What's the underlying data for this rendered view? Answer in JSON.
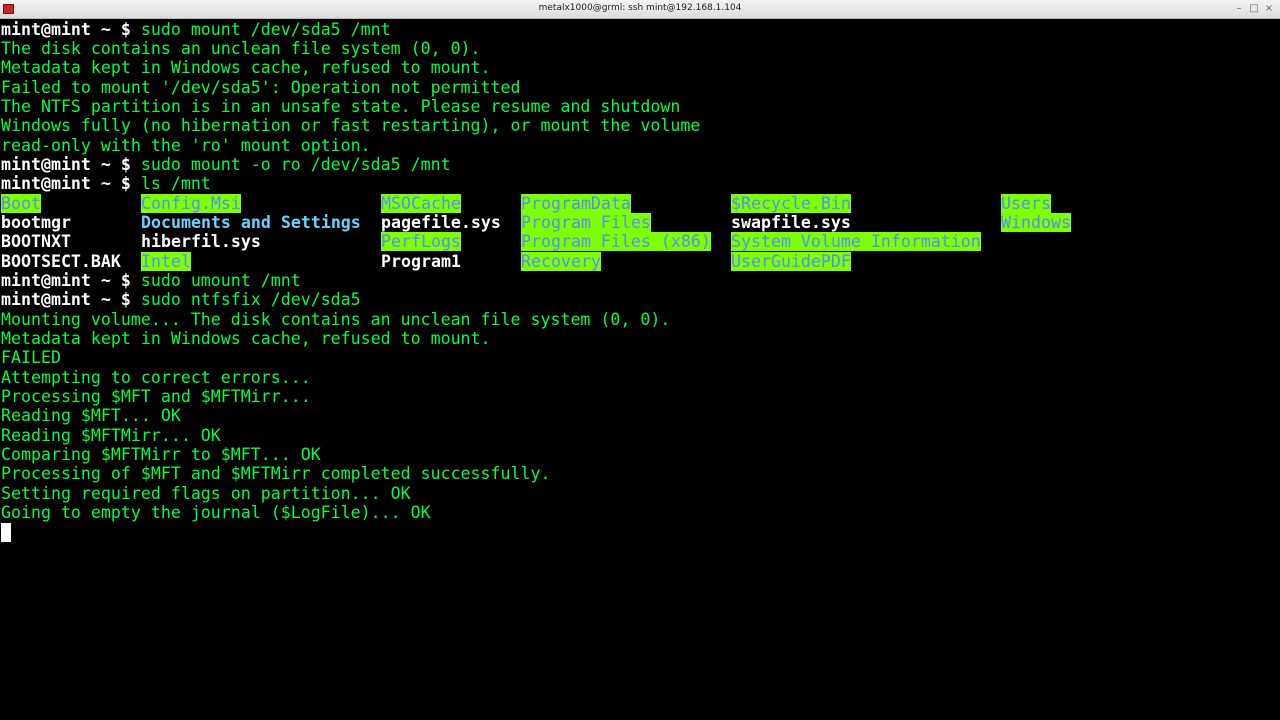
{
  "window": {
    "title": "metalx1000@grml: ssh mint@192.168.1.104",
    "controls": {
      "minimize": "–",
      "maximize": "□",
      "close": "×"
    }
  },
  "terminal": {
    "prompt": "mint@mint ~ $",
    "lines": [
      {
        "prompt": "mint@mint ~ $",
        "text": " sudo mount /dev/sda5 /mnt"
      },
      {
        "text": "The disk contains an unclean file system (0, 0)."
      },
      {
        "text": "Metadata kept in Windows cache, refused to mount."
      },
      {
        "text": "Failed to mount '/dev/sda5': Operation not permitted"
      },
      {
        "text": "The NTFS partition is in an unsafe state. Please resume and shutdown"
      },
      {
        "text": "Windows fully (no hibernation or fast restarting), or mount the volume"
      },
      {
        "text": "read-only with the 'ro' mount option."
      },
      {
        "prompt": "mint@mint ~ $",
        "text": " sudo mount -o ro /dev/sda5 /mnt"
      },
      {
        "prompt": "mint@mint ~ $",
        "text": " ls /mnt"
      }
    ],
    "ls_output": {
      "row1": [
        "Boot",
        "Config.Msi",
        "MSOCache",
        "ProgramData",
        "$Recycle.Bin",
        "Users"
      ],
      "row2": [
        "bootmgr",
        "Documents and Settings",
        "pagefile.sys",
        "Program Files",
        "swapfile.sys",
        "Windows"
      ],
      "row3": [
        "BOOTNXT",
        "hiberfil.sys",
        "PerfLogs",
        "Program Files (x86)",
        "System Volume Information"
      ],
      "row4": [
        "BOOTSECT.BAK",
        "Intel",
        "Program1",
        "Recovery",
        "UserGuidePDF"
      ]
    },
    "lines_after": [
      {
        "prompt": "mint@mint ~ $",
        "text": " sudo umount /mnt"
      },
      {
        "prompt": "mint@mint ~ $",
        "text": " sudo ntfsfix /dev/sda5"
      },
      {
        "text": "Mounting volume... The disk contains an unclean file system (0, 0)."
      },
      {
        "text": "Metadata kept in Windows cache, refused to mount."
      },
      {
        "text": "FAILED"
      },
      {
        "text": "Attempting to correct errors..."
      },
      {
        "text": "Processing $MFT and $MFTMirr..."
      },
      {
        "text": "Reading $MFT... OK"
      },
      {
        "text": "Reading $MFTMirr... OK"
      },
      {
        "text": "Comparing $MFTMirr to $MFT... OK"
      },
      {
        "text": "Processing of $MFT and $MFTMirr completed successfully."
      },
      {
        "text": "Setting required flags on partition... OK"
      },
      {
        "text": "Going to empty the journal ($LogFile)... OK"
      }
    ]
  },
  "colors": {
    "background": "#000000",
    "output_text": "#00ff40",
    "prompt_text": "#ffffff",
    "highlight_bg": "#7cff00",
    "highlight_fg": "#5a8cff",
    "directory": "#6ad2ff"
  }
}
